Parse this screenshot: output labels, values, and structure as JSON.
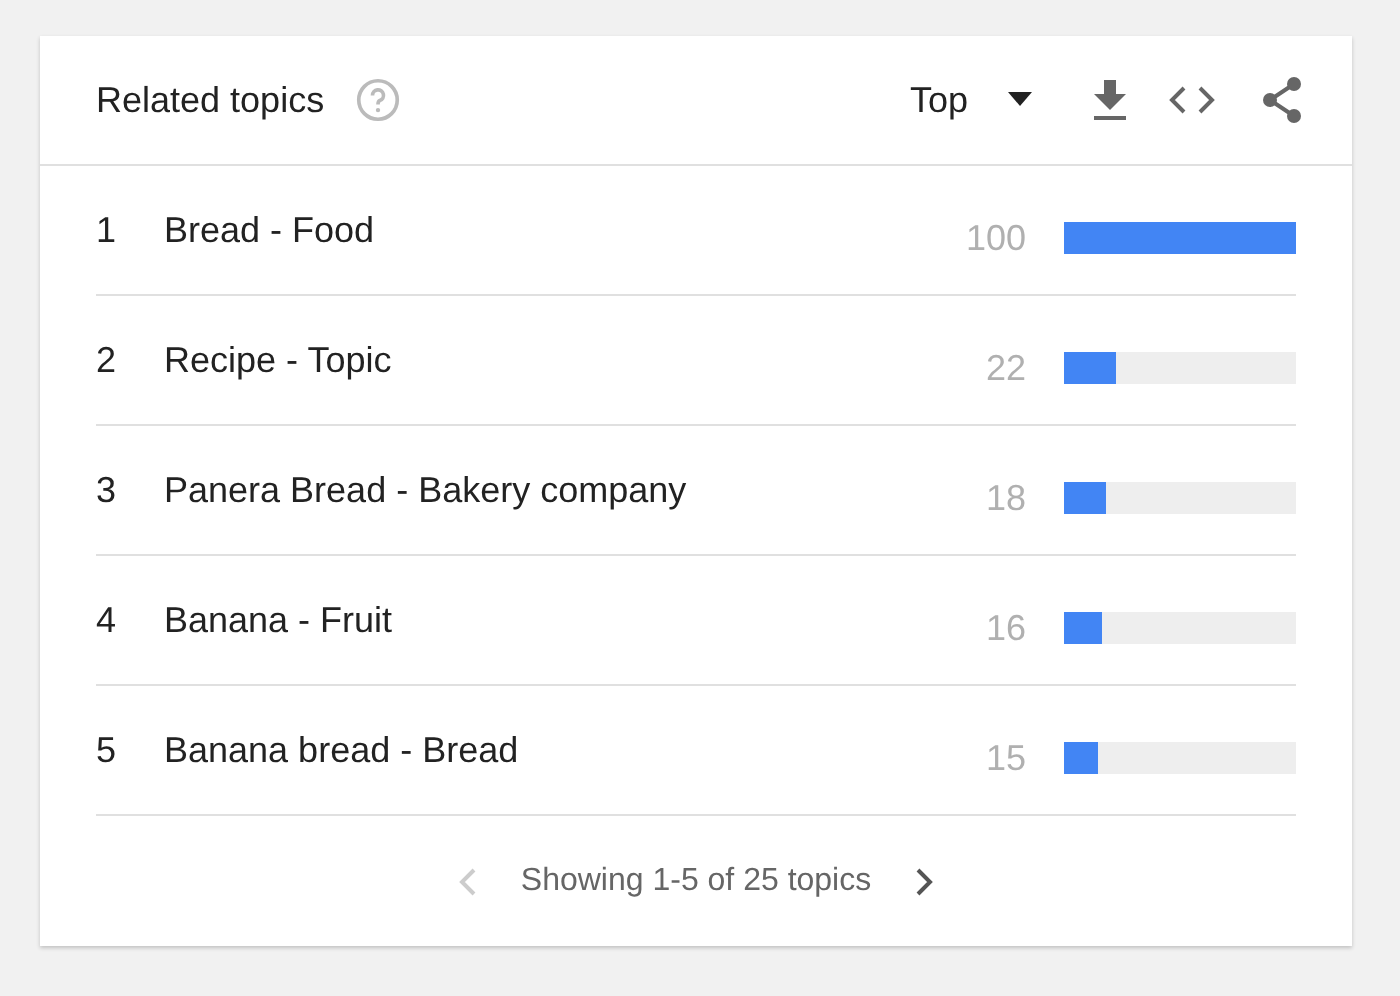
{
  "card": {
    "title": "Related topics",
    "sort": "Top"
  },
  "rows": [
    {
      "rank": "1",
      "label": "Bread - Food",
      "value": "100",
      "level": 1.0
    },
    {
      "rank": "2",
      "label": "Recipe - Topic",
      "value": "22",
      "level": 0.22
    },
    {
      "rank": "3",
      "label": "Panera Bread - Bakery company",
      "value": "18",
      "level": 0.18
    },
    {
      "rank": "4",
      "label": "Banana - Fruit",
      "value": "16",
      "level": 0.16
    },
    {
      "rank": "5",
      "label": "Banana bread - Bread",
      "value": "15",
      "level": 0.15
    }
  ],
  "pagination": {
    "text": "Showing 1-5 of 25 topics",
    "prev_disabled": true,
    "next_disabled": false
  }
}
